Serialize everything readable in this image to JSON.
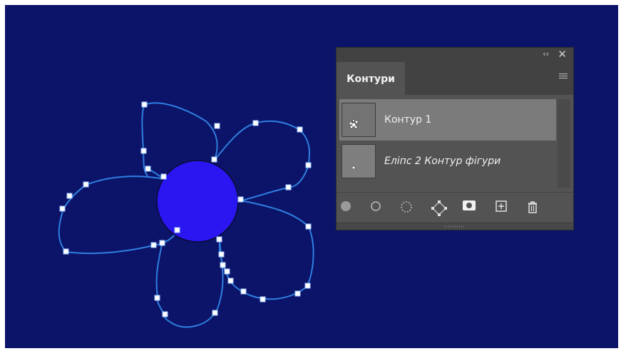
{
  "panel": {
    "tab_label": "Контури",
    "collapse_glyph": "‹‹",
    "close_glyph": "✕",
    "paths": [
      {
        "label": "Контур 1",
        "selected": true,
        "italic": false
      },
      {
        "label": "Еліпс 2 Контур фігури",
        "selected": false,
        "italic": true
      }
    ],
    "toolbar_icons": [
      "fill-path-icon",
      "stroke-path-icon",
      "load-selection-icon",
      "make-work-path-icon",
      "add-mask-icon",
      "new-path-icon",
      "delete-path-icon"
    ]
  },
  "colors": {
    "canvas_background": "#0b1468",
    "circle_fill": "#2a16f0",
    "path_stroke": "#2f7fe0",
    "anchor_fill": "#ffffff",
    "panel_background": "#535353",
    "selected_row": "#7b7b7b"
  }
}
